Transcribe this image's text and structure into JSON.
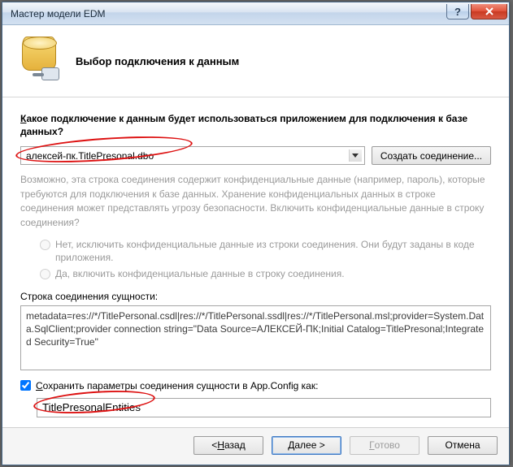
{
  "window": {
    "title": "Мастер модели EDM"
  },
  "header": {
    "title": "Выбор подключения к данным"
  },
  "question": {
    "prefix_u": "К",
    "rest": "акое подключение к данным будет использоваться приложением для подключения к базе данных?"
  },
  "connection": {
    "selected": "алексей-пк.TitlePresonal.dbo",
    "create_btn": "Создать соединение..."
  },
  "warning_text": "Возможно, эта строка соединения содержит конфиденциальные данные (например, пароль), которые требуются для подключения к базе данных. Хранение конфиденциальных данных в строке соединения может представлять угрозу безопасности. Включить конфиденциальные данные в строку соединения?",
  "radios": {
    "no_text": "Нет, исключить конфиденциальные данные из строки соединения. Они будут заданы в коде приложения.",
    "yes_text": "Да, включить конфиденциальные данные в строку соединения."
  },
  "cs_label": "Строка соединения сущности:",
  "cs_value": "metadata=res://*/TitlePersonal.csdl|res://*/TitlePersonal.ssdl|res://*/TitlePersonal.msl;provider=System.Data.SqlClient;provider connection string=\"Data Source=АЛЕКСЕЙ-ПК;Initial Catalog=TitlePresonal;Integrated Security=True\"",
  "save_check": {
    "prefix": "С",
    "rest": "охранить параметры соединения сущности в App.Config как:"
  },
  "entities_name": "TitlePresonalEntities",
  "buttons": {
    "back_pre": "< ",
    "back_u": "Н",
    "back_rest": "азад",
    "next_pre": "Д",
    "next_rest": "алее >",
    "finish_u": "Г",
    "finish_rest": "отово",
    "cancel": "Отмена"
  }
}
